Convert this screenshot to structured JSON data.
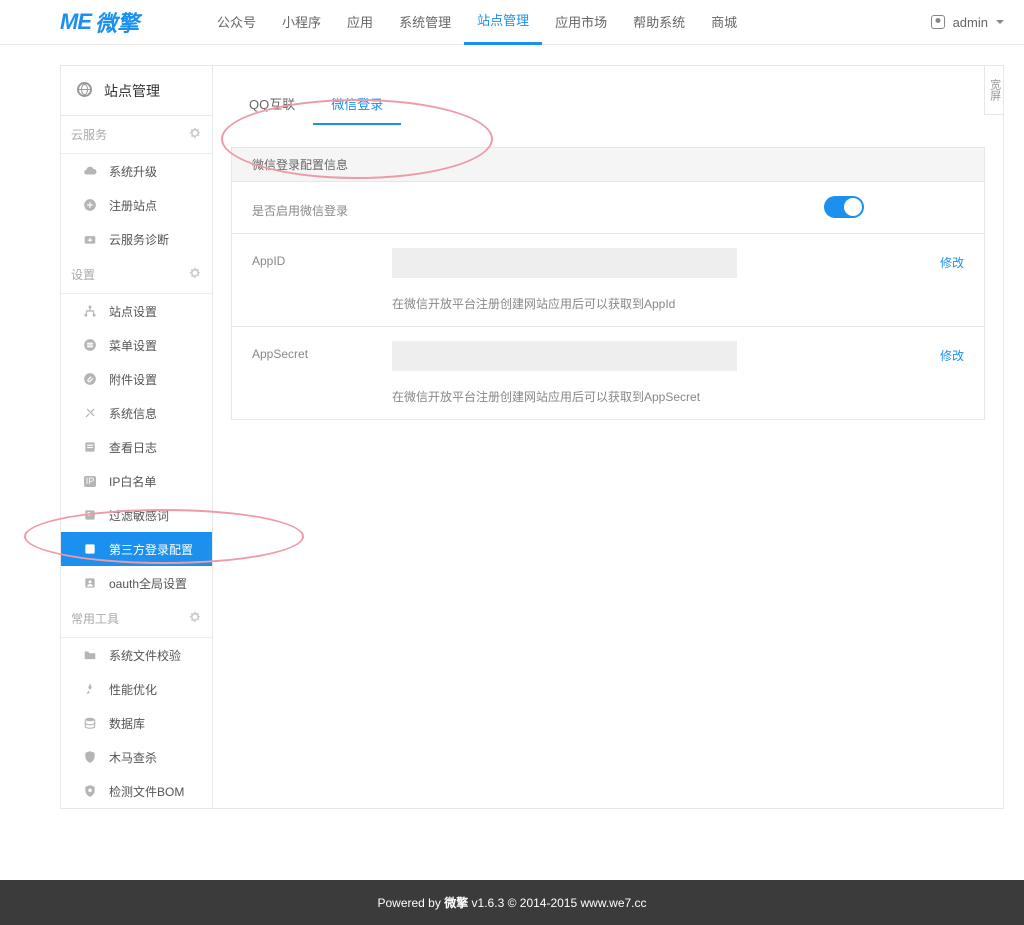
{
  "logo": {
    "prefix": "ME",
    "text": "微擎"
  },
  "topnav": {
    "items": [
      "公众号",
      "小程序",
      "应用",
      "系统管理",
      "站点管理",
      "应用市场",
      "帮助系统",
      "商城"
    ],
    "active_index": 4
  },
  "user": {
    "name": "admin"
  },
  "sidebar": {
    "title": "站点管理",
    "sections": [
      {
        "label": "云服务",
        "items": [
          {
            "label": "系统升级",
            "icon": "cloud-icon"
          },
          {
            "label": "注册站点",
            "icon": "plus-circle-icon"
          },
          {
            "label": "云服务诊断",
            "icon": "medkit-icon"
          }
        ]
      },
      {
        "label": "设置",
        "items": [
          {
            "label": "站点设置",
            "icon": "sitemap-icon"
          },
          {
            "label": "菜单设置",
            "icon": "list-icon"
          },
          {
            "label": "附件设置",
            "icon": "paperclip-icon"
          },
          {
            "label": "系统信息",
            "icon": "tools-icon"
          },
          {
            "label": "查看日志",
            "icon": "log-icon"
          },
          {
            "label": "IP白名单",
            "icon": "ip-icon"
          },
          {
            "label": "过滤敏感词",
            "icon": "filter-icon"
          },
          {
            "label": "第三方登录配置",
            "icon": "login-icon",
            "active": true
          },
          {
            "label": "oauth全局设置",
            "icon": "oauth-icon"
          }
        ]
      },
      {
        "label": "常用工具",
        "items": [
          {
            "label": "系统文件校验",
            "icon": "folder-icon"
          },
          {
            "label": "性能优化",
            "icon": "rocket-icon"
          },
          {
            "label": "数据库",
            "icon": "database-icon"
          },
          {
            "label": "木马查杀",
            "icon": "shield-icon"
          },
          {
            "label": "检测文件BOM",
            "icon": "bom-icon"
          }
        ]
      }
    ]
  },
  "wide_button": "宽屏",
  "tabs": {
    "items": [
      "QQ互联",
      "微信登录"
    ],
    "active_index": 1
  },
  "form": {
    "header": "微信登录配置信息",
    "rows": [
      {
        "label": "是否启用微信登录",
        "type": "switch",
        "on": true
      },
      {
        "label": "AppID",
        "type": "input",
        "value": "",
        "help": "在微信开放平台注册创建网站应用后可以获取到AppId",
        "action": "修改"
      },
      {
        "label": "AppSecret",
        "type": "input",
        "value": "",
        "help": "在微信开放平台注册创建网站应用后可以获取到AppSecret",
        "action": "修改"
      }
    ]
  },
  "footer": {
    "powered_by": "Powered by",
    "product": "微擎",
    "version": "v1.6.3",
    "copyright": "© 2014-2015",
    "url": "www.we7.cc"
  }
}
